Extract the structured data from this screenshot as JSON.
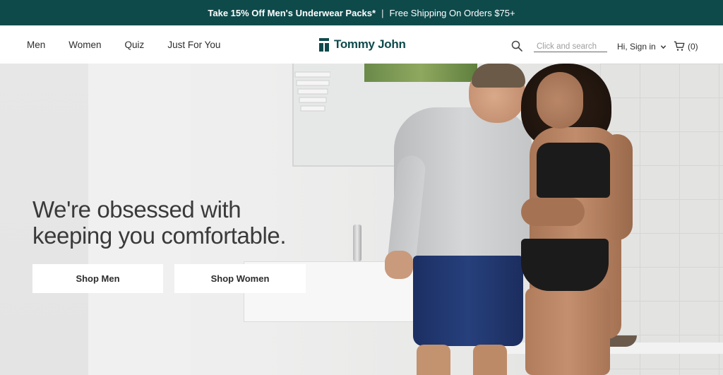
{
  "promo": {
    "offer": "Take 15% Off Men's Underwear Packs*",
    "separator": "|",
    "shipping": "Free Shipping On Orders $75+"
  },
  "nav": {
    "items": [
      {
        "label": "Men"
      },
      {
        "label": "Women"
      },
      {
        "label": "Quiz"
      },
      {
        "label": "Just For You"
      }
    ]
  },
  "brand": {
    "name": "Tommy John",
    "color": "#0f4a4b"
  },
  "header": {
    "search_placeholder": "Click and search",
    "signin_label": "Hi, Sign in",
    "cart_count": "(0)"
  },
  "hero": {
    "headline_line1": "We're obsessed with",
    "headline_line2": "keeping you comfortable.",
    "cta_men": "Shop Men",
    "cta_women": "Shop Women"
  },
  "icons": [
    "search-icon",
    "chevron-down-icon",
    "cart-icon",
    "brand-logo-mark"
  ]
}
